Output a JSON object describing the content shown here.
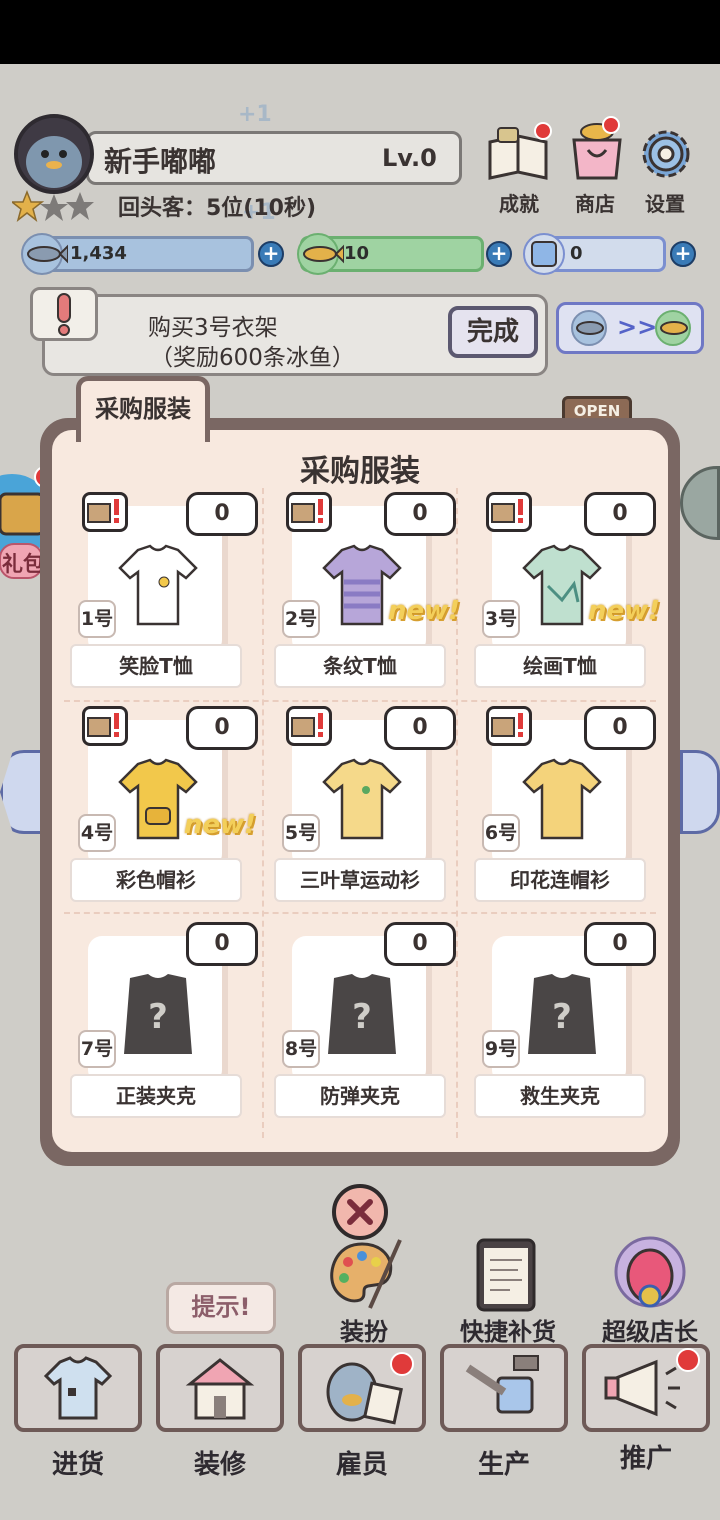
{
  "player": {
    "name": "新手嘟嘟",
    "level": "Lv.0",
    "customers": "回头客：5位(10秒)",
    "float_plus": "+1"
  },
  "top_menu": [
    {
      "label": "成就",
      "icon": "book-icon"
    },
    {
      "label": "商店",
      "icon": "shop-bag-icon"
    },
    {
      "label": "设置",
      "icon": "gear-icon"
    }
  ],
  "currencies": [
    {
      "icon": "blue-fish-icon",
      "value": "1,434"
    },
    {
      "icon": "gold-fish-icon",
      "value": "10"
    },
    {
      "icon": "ice-cube-icon",
      "value": "0"
    }
  ],
  "task": {
    "line1": "购买3号衣架",
    "line2": "（奖励600条冰鱼）",
    "done_label": "完成",
    "exchange_label": ">>"
  },
  "modal": {
    "tab_label": "采购服装",
    "title": "采购服装",
    "items": [
      {
        "num": "1号",
        "name": "笑脸T恤",
        "count": "0",
        "is_new": false,
        "locked": false,
        "new_label": ""
      },
      {
        "num": "2号",
        "name": "条纹T恤",
        "count": "0",
        "is_new": true,
        "locked": false,
        "new_label": "new!"
      },
      {
        "num": "3号",
        "name": "绘画T恤",
        "count": "0",
        "is_new": true,
        "locked": false,
        "new_label": "new!"
      },
      {
        "num": "4号",
        "name": "彩色帽衫",
        "count": "0",
        "is_new": true,
        "locked": false,
        "new_label": "new!"
      },
      {
        "num": "5号",
        "name": "三叶草运动衫",
        "count": "0",
        "is_new": false,
        "locked": false,
        "new_label": ""
      },
      {
        "num": "6号",
        "name": "印花连帽衫",
        "count": "0",
        "is_new": false,
        "locked": false,
        "new_label": ""
      },
      {
        "num": "7号",
        "name": "正装夹克",
        "count": "0",
        "is_new": false,
        "locked": true,
        "new_label": ""
      },
      {
        "num": "8号",
        "name": "防弹夹克",
        "count": "0",
        "is_new": false,
        "locked": true,
        "new_label": ""
      },
      {
        "num": "9号",
        "name": "救生夹克",
        "count": "0",
        "is_new": false,
        "locked": true,
        "new_label": ""
      }
    ]
  },
  "side": {
    "gift_label": "礼包",
    "open_sign": "OPEN"
  },
  "hint_label": "提示!",
  "mid_actions": [
    {
      "label": "装扮",
      "icon": "palette-icon"
    },
    {
      "label": "快捷补货",
      "icon": "clipboard-icon"
    },
    {
      "label": "超级店长",
      "icon": "manager-icon"
    }
  ],
  "bottom_nav": [
    {
      "label": "进货",
      "icon": "tshirt-icon"
    },
    {
      "label": "装修",
      "icon": "house-icon"
    },
    {
      "label": "雇员",
      "icon": "employee-icon"
    },
    {
      "label": "生产",
      "icon": "production-icon"
    },
    {
      "label": "推广",
      "icon": "megaphone-icon"
    }
  ],
  "colors": {
    "modal_border": "#7a6763",
    "modal_bg": "#f8e9df",
    "new_tag": "#f3cf5a",
    "notify": "#e03a3a"
  }
}
